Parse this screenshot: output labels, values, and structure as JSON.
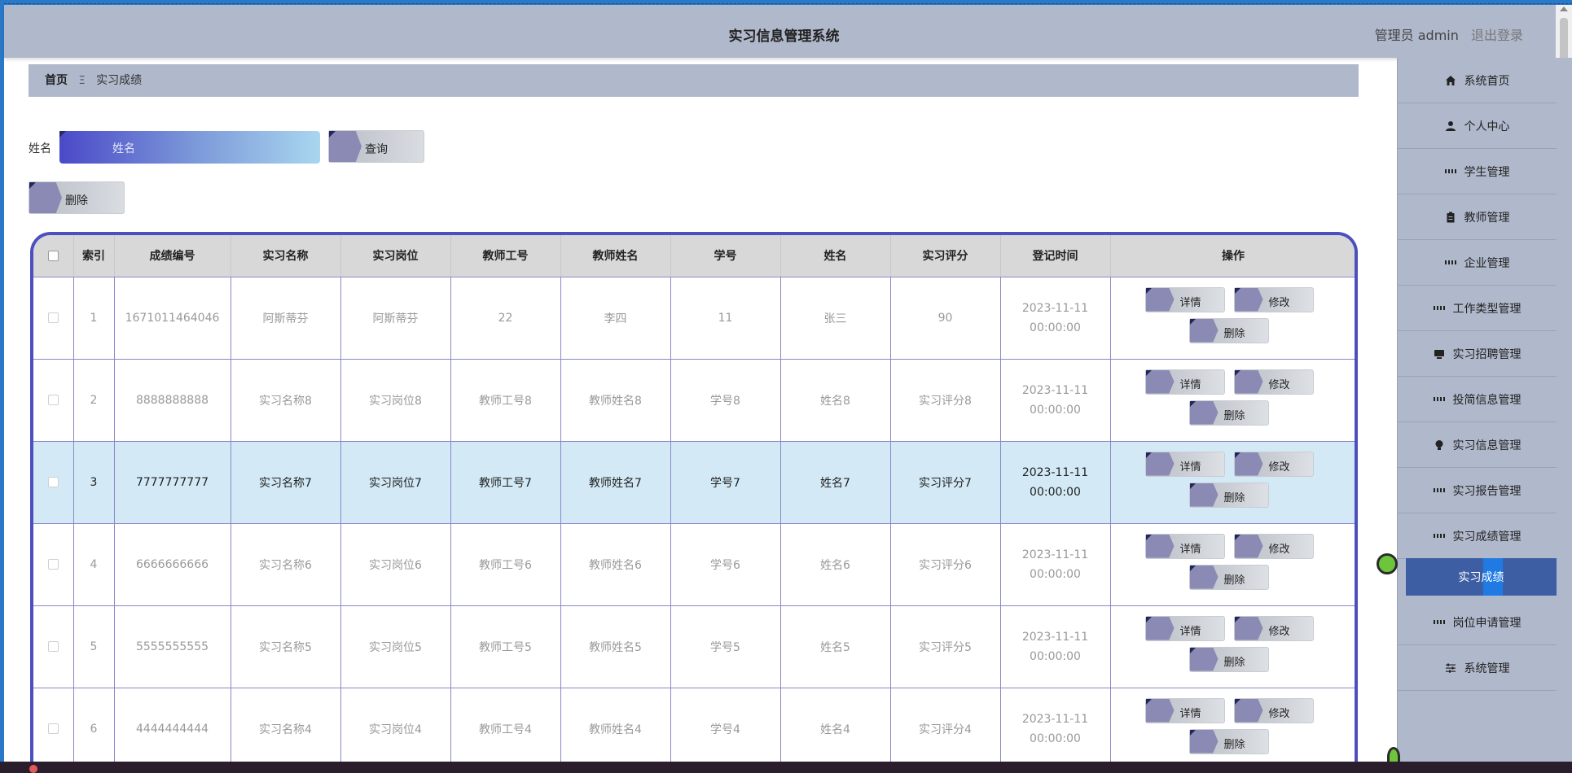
{
  "app": {
    "title": "实习信息管理系统"
  },
  "header": {
    "user": "管理员 admin",
    "logout": "退出登录"
  },
  "breadcrumb": {
    "home": "首页",
    "separator": "Ξ",
    "current": "实习成绩"
  },
  "search": {
    "label": "姓名",
    "placeholder": "姓名",
    "query_label": "查询"
  },
  "toolbar": {
    "delete_label": "删除"
  },
  "table": {
    "columns": [
      "索引",
      "成绩编号",
      "实习名称",
      "实习岗位",
      "教师工号",
      "教师姓名",
      "学号",
      "姓名",
      "实习评分",
      "登记时间",
      "操作"
    ],
    "rows": [
      {
        "index": "1",
        "code": "1671011464046",
        "name": "阿斯蒂芬",
        "post": "阿斯蒂芬",
        "teacher_no": "22",
        "teacher_name": "李四",
        "student_no": "11",
        "student_name": "张三",
        "score": "90",
        "time": "2023-11-11 00:00:00"
      },
      {
        "index": "2",
        "code": "8888888888",
        "name": "实习名称8",
        "post": "实习岗位8",
        "teacher_no": "教师工号8",
        "teacher_name": "教师姓名8",
        "student_no": "学号8",
        "student_name": "姓名8",
        "score": "实习评分8",
        "time": "2023-11-11 00:00:00"
      },
      {
        "index": "3",
        "code": "7777777777",
        "name": "实习名称7",
        "post": "实习岗位7",
        "teacher_no": "教师工号7",
        "teacher_name": "教师姓名7",
        "student_no": "学号7",
        "student_name": "姓名7",
        "score": "实习评分7",
        "time": "2023-11-11 00:00:00"
      },
      {
        "index": "4",
        "code": "6666666666",
        "name": "实习名称6",
        "post": "实习岗位6",
        "teacher_no": "教师工号6",
        "teacher_name": "教师姓名6",
        "student_no": "学号6",
        "student_name": "姓名6",
        "score": "实习评分6",
        "time": "2023-11-11 00:00:00"
      },
      {
        "index": "5",
        "code": "5555555555",
        "name": "实习名称5",
        "post": "实习岗位5",
        "teacher_no": "教师工号5",
        "teacher_name": "教师姓名5",
        "student_no": "学号5",
        "student_name": "姓名5",
        "score": "实习评分5",
        "time": "2023-11-11 00:00:00"
      },
      {
        "index": "6",
        "code": "4444444444",
        "name": "实习名称4",
        "post": "实习岗位4",
        "teacher_no": "教师工号4",
        "teacher_name": "教师姓名4",
        "student_no": "学号4",
        "student_name": "姓名4",
        "score": "实习评分4",
        "time": "2023-11-11 00:00:00"
      }
    ],
    "actions": {
      "detail": "详情",
      "edit": "修改",
      "delete": "删除"
    }
  },
  "sidebar": {
    "items": [
      {
        "label": "系统首页",
        "icon": "home-icon"
      },
      {
        "label": "个人中心",
        "icon": "user-icon"
      },
      {
        "label": "学生管理",
        "icon": "grid-icon"
      },
      {
        "label": "教师管理",
        "icon": "clipboard-icon"
      },
      {
        "label": "企业管理",
        "icon": "grid-icon"
      },
      {
        "label": "工作类型管理",
        "icon": "grid-icon"
      },
      {
        "label": "实习招聘管理",
        "icon": "monitor-icon"
      },
      {
        "label": "投简信息管理",
        "icon": "grid-icon"
      },
      {
        "label": "实习信息管理",
        "icon": "bulb-icon"
      },
      {
        "label": "实习报告管理",
        "icon": "grid-icon"
      },
      {
        "label": "实习成绩管理",
        "icon": "grid-icon"
      },
      {
        "label": "实习成绩",
        "icon": "",
        "sub": true
      },
      {
        "label": "岗位申请管理",
        "icon": "grid-icon"
      },
      {
        "label": "系统管理",
        "icon": "sliders-icon"
      }
    ]
  },
  "colors": {
    "header_bg": "#b0b8cb",
    "table_border": "#4d4fbe",
    "selected_row": "#d3eaf6",
    "active_menu": "#3d5ea3"
  }
}
